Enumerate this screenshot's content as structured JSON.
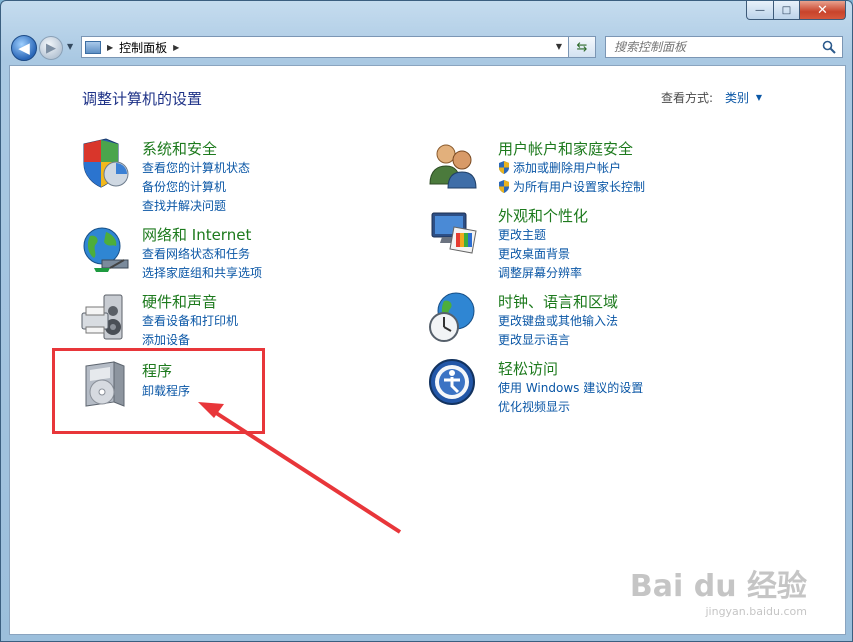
{
  "window": {
    "caption": {
      "min": "—",
      "max": "□",
      "close": "✕"
    }
  },
  "nav": {
    "back_glyph": "◀",
    "fwd_glyph": "▶",
    "breadcrumb": "控制面板",
    "search_placeholder": "搜索控制面板"
  },
  "main": {
    "title": "调整计算机的设置",
    "viewby_label": "查看方式:",
    "viewby_value": "类别"
  },
  "categories": [
    {
      "title": "系统和安全",
      "links": [
        "查看您的计算机状态",
        "备份您的计算机",
        "查找并解决问题"
      ],
      "icon": "system-security-icon"
    },
    {
      "title": "网络和 Internet",
      "links": [
        "查看网络状态和任务",
        "选择家庭组和共享选项"
      ],
      "icon": "network-icon"
    },
    {
      "title": "硬件和声音",
      "links": [
        "查看设备和打印机",
        "添加设备"
      ],
      "icon": "hardware-sound-icon"
    },
    {
      "title": "程序",
      "links": [
        "卸载程序"
      ],
      "icon": "programs-icon"
    },
    {
      "title": "用户帐户和家庭安全",
      "links": [
        "添加或删除用户帐户",
        "为所有用户设置家长控制"
      ],
      "icon": "user-accounts-icon"
    },
    {
      "title": "外观和个性化",
      "links": [
        "更改主题",
        "更改桌面背景",
        "调整屏幕分辨率"
      ],
      "icon": "appearance-icon"
    },
    {
      "title": "时钟、语言和区域",
      "links": [
        "更改键盘或其他输入法",
        "更改显示语言"
      ],
      "icon": "clock-region-icon"
    },
    {
      "title": "轻松访问",
      "links": [
        "使用 Windows 建议的设置",
        "优化视频显示"
      ],
      "icon": "ease-of-access-icon"
    }
  ],
  "watermark": {
    "brand": "Bai du 经验",
    "url": "jingyan.baidu.com"
  },
  "colors": {
    "title": "#1d7a1d",
    "link": "#0b57a6",
    "highlight": "#e8363a"
  }
}
